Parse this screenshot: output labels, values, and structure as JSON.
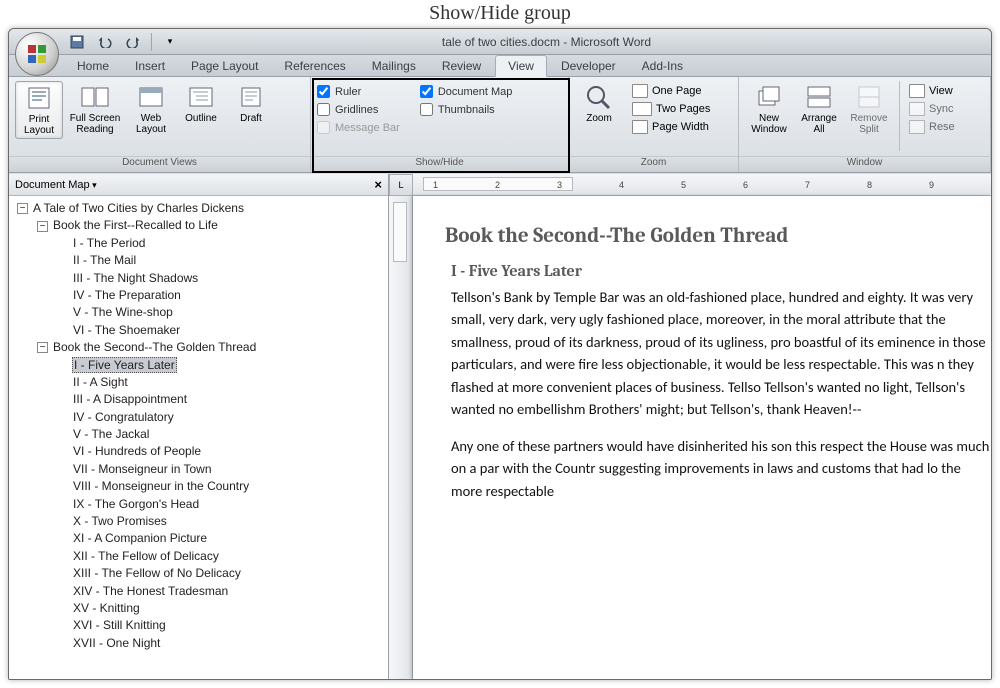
{
  "annotation": "Show/Hide group",
  "title": "tale of two cities.docm - Microsoft Word",
  "tabs": [
    "Home",
    "Insert",
    "Page Layout",
    "References",
    "Mailings",
    "Review",
    "View",
    "Developer",
    "Add-Ins"
  ],
  "active_tab": "View",
  "ribbon": {
    "views_group": "Document Views",
    "views": {
      "print": "Print Layout",
      "reading": "Full Screen Reading",
      "web": "Web Layout",
      "outline": "Outline",
      "draft": "Draft"
    },
    "showhide_group": "Show/Hide",
    "showhide": {
      "ruler": "Ruler",
      "gridlines": "Gridlines",
      "msgbar": "Message Bar",
      "docmap": "Document Map",
      "thumbs": "Thumbnails"
    },
    "zoom_group": "Zoom",
    "zoom": {
      "zoom": "Zoom",
      "one": "One Page",
      "two": "Two Pages",
      "width": "Page Width"
    },
    "window_group": "Window",
    "window": {
      "new": "New Window",
      "arrange": "Arrange All",
      "remove": "Remove Split",
      "view": "View",
      "sync": "Sync",
      "reset": "Rese"
    }
  },
  "docmap": {
    "title": "Document Map",
    "root": "A Tale of Two Cities  by Charles Dickens",
    "book1": "Book the First--Recalled to Life",
    "b1": [
      "I - The Period",
      "II - The Mail",
      "III - The Night Shadows",
      "IV - The Preparation",
      "V - The Wine-shop",
      "VI - The Shoemaker"
    ],
    "book2": "Book the Second--The Golden Thread",
    "b2": [
      "I - Five Years Later",
      "II - A Sight",
      "III - A Disappointment",
      "IV - Congratulatory",
      "V - The Jackal",
      "VI - Hundreds of People",
      "VII - Monseigneur in Town",
      "VIII - Monseigneur in the Country",
      "IX - The Gorgon's Head",
      "X - Two Promises",
      "XI - A Companion Picture",
      "XII - The Fellow of Delicacy",
      "XIII - The Fellow of No Delicacy",
      "XIV - The Honest Tradesman",
      "XV - Knitting",
      "XVI - Still Knitting",
      "XVII - One Night"
    ]
  },
  "doc": {
    "h1": "Book the Second--The Golden Thread",
    "h2": "I - Five Years Later",
    "p1": " Tellson's Bank by Temple Bar was an old-fashioned place, hundred and eighty.  It was very small, very dark, very ugly fashioned place, moreover, in the moral attribute that the smallness, proud of its darkness, proud of its ugliness, pro boastful of its eminence in those particulars, and were fire less objectionable, it would be less respectable. This was n they flashed at more convenient places of business.  Tellso Tellson's wanted no light, Tellson's wanted no embellishm Brothers' might; but Tellson's, thank Heaven!--",
    "p2": "Any one of these partners would have disinherited his son this respect the House was much on a par with the Countr suggesting improvements in laws and customs that had lo the more respectable"
  },
  "ruler_ticks": [
    "1",
    "2",
    "3",
    "4",
    "5",
    "6",
    "7",
    "8",
    "9"
  ]
}
